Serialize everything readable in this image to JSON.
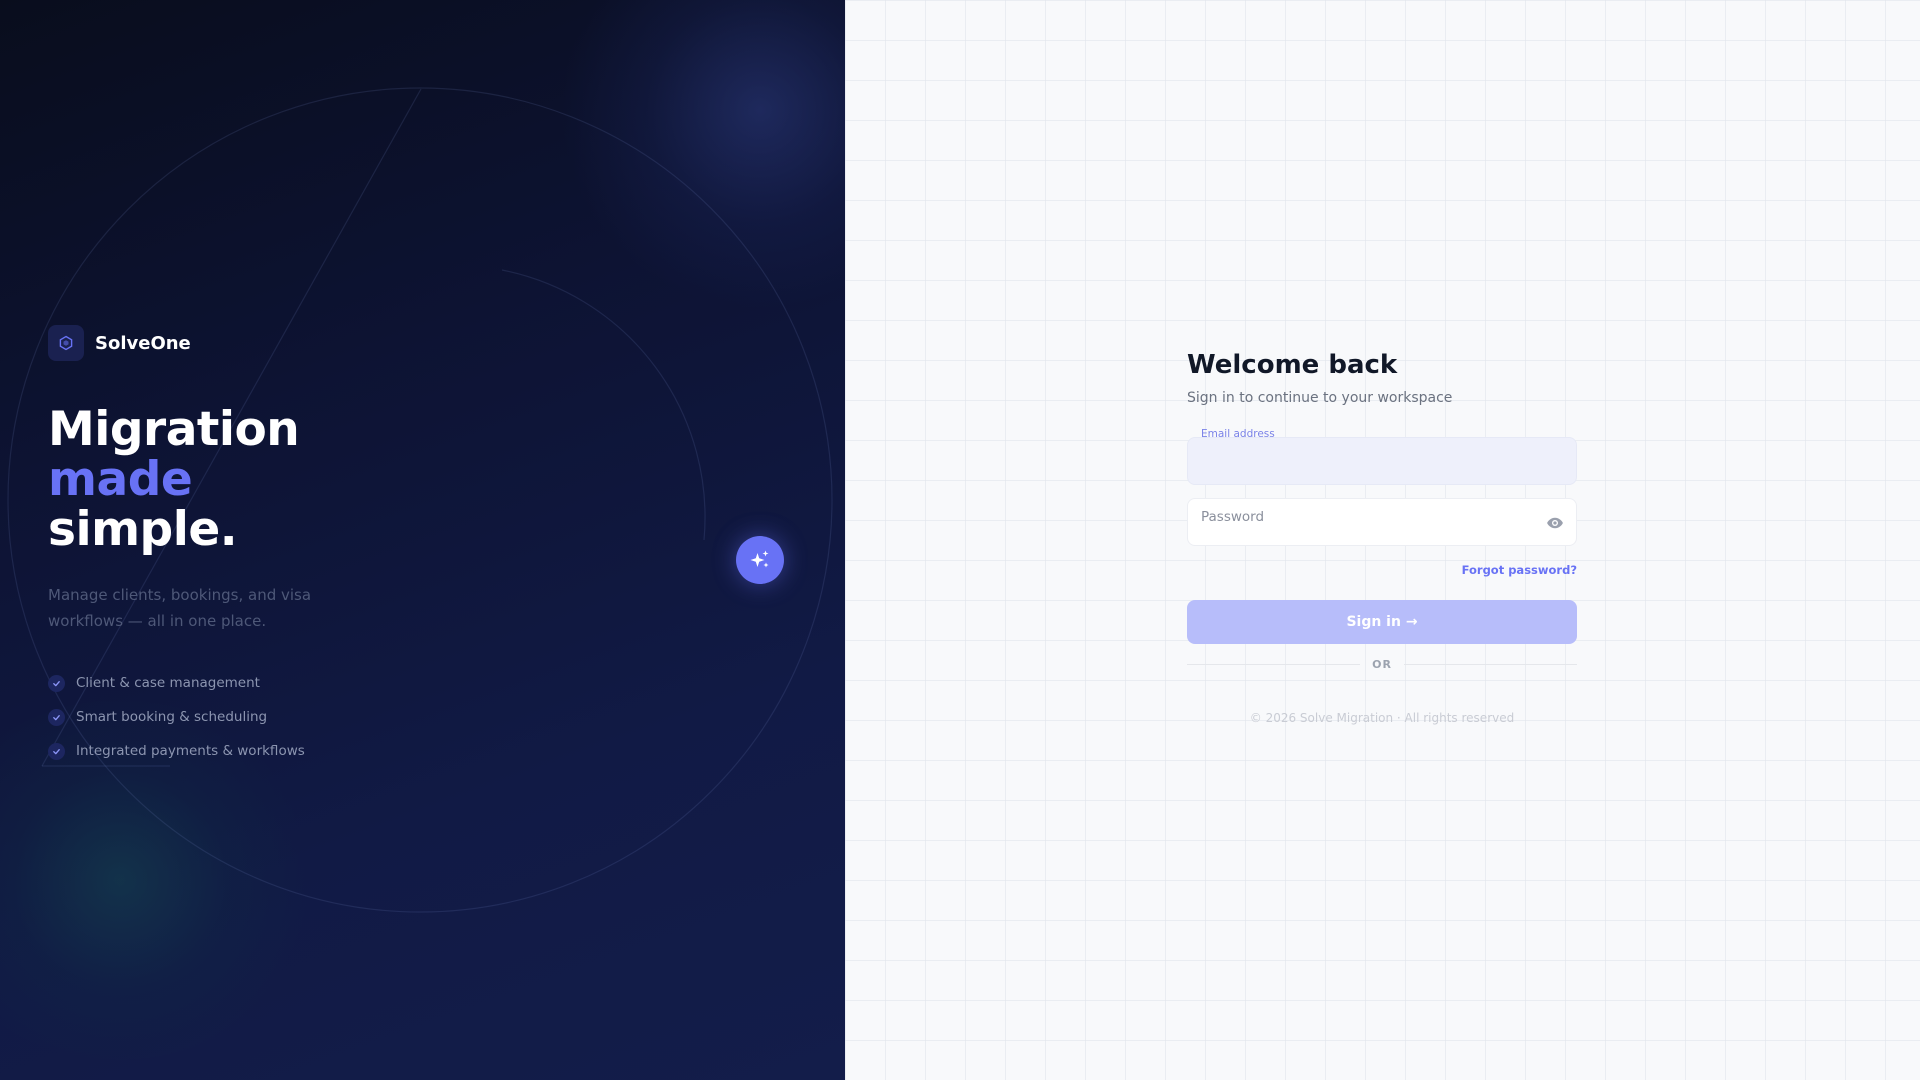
{
  "brand": {
    "name": "SolveOne",
    "icon": "hexagon-logo-icon"
  },
  "hero": {
    "headline_line1": "Migration",
    "headline_accent": "made",
    "headline_line3": "simple.",
    "tagline": "Manage clients, bookings, and visa workflows — all in one place.",
    "features": [
      {
        "label": "Client & case management",
        "icon": "check-icon"
      },
      {
        "label": "Smart booking & scheduling",
        "icon": "check-icon"
      },
      {
        "label": "Integrated payments & workflows",
        "icon": "check-icon"
      }
    ],
    "fab_icon": "sparkles-icon"
  },
  "form": {
    "title": "Welcome back",
    "subtitle": "Sign in to continue to your workspace",
    "email_label": "Email address",
    "email_value": "",
    "password_placeholder": "Password",
    "password_value": "",
    "password_toggle_icon": "eye-icon",
    "forgot_label": "Forgot password?",
    "signin_label": "Sign in →",
    "divider_label": "OR",
    "footer": "© 2026 Solve Migration · All rights reserved"
  },
  "colors": {
    "accent": "#6872f5",
    "hero_bg": "#0d1333",
    "button_disabled": "#b7bdfa",
    "title_text": "#111828"
  }
}
